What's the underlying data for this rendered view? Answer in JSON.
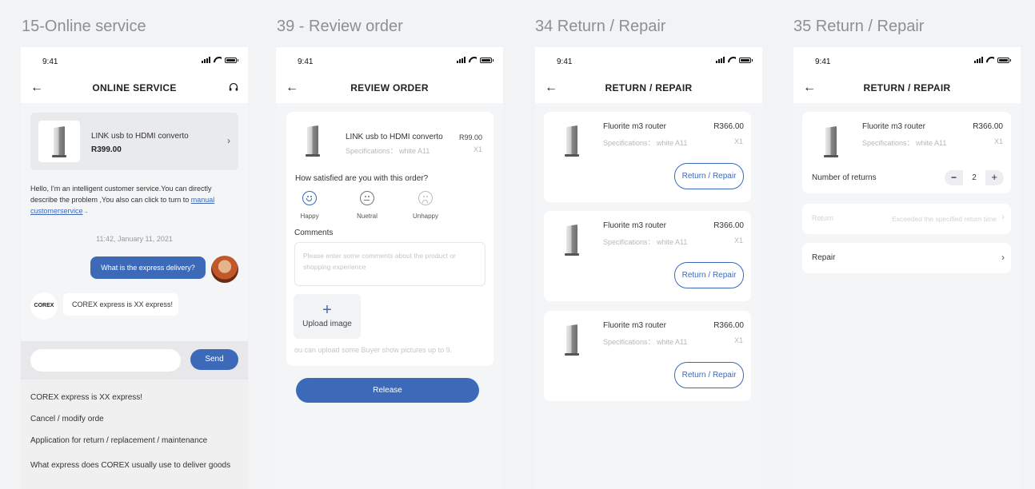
{
  "screens": {
    "s1": {
      "label": "15-Online service"
    },
    "s2": {
      "label": "39 - Review order"
    },
    "s3": {
      "label": "34  Return / Repair"
    },
    "s4": {
      "label": "35 Return / Repair"
    }
  },
  "status": {
    "time": "9:41"
  },
  "icons": {
    "back": "arrow-left-icon",
    "headset": "headset-icon",
    "chevron": "chevron-right-icon",
    "plus": "plus-icon"
  },
  "colors": {
    "accent": "#3d6ab8",
    "background": "#f4f5f7"
  },
  "online": {
    "title": "ONLINE SERVICE",
    "product": {
      "name": "LINK usb to HDMI converto",
      "price": "R399.00"
    },
    "intro_text": "Hello, I'm an intelligent customer service.You can directly describe the problem ,You  also can click to turn to ",
    "intro_link": "manual customerservice",
    "intro_link_arrow": "→",
    "timestamp": "11:42, January 11, 2021",
    "user_message": "What is the express delivery?",
    "bot_avatar": "COREX",
    "bot_message": "COREX express is XX express!",
    "input_placeholder": "",
    "send_label": "Send",
    "quick_questions": [
      "COREX express is XX express!",
      "Cancel / modify orde",
      "Application for return / replacement / maintenance",
      "What express does COREX usually use to deliver goods"
    ]
  },
  "review": {
    "title": "REVIEW ORDER",
    "product": {
      "name": "LINK usb to HDMI converto",
      "price": "R99.00",
      "spec": "Specifications： white A11",
      "qty": "X1"
    },
    "question": "How satisfied are you with this order?",
    "ratings": [
      {
        "label": "Happy",
        "icon": "happy-face-icon"
      },
      {
        "label": "Nuetral",
        "icon": "neutral-face-icon"
      },
      {
        "label": "Unhappy",
        "icon": "sad-face-icon"
      }
    ],
    "comments_label": "Comments",
    "comments_placeholder": "Please enter some comments about the product or shopping experience",
    "upload_label": "Upload image",
    "upload_hint": "ou can upload some Buyer show pictures up to 9.",
    "release_label": "Release"
  },
  "return_list": {
    "title": "RETURN / REPAIR",
    "items": [
      {
        "name": "Fluorite m3 router",
        "price": "R366.00",
        "spec": "Specifications： white A11",
        "qty": "X1",
        "button": "Return / Repair"
      },
      {
        "name": "Fluorite m3 router",
        "price": "R366.00",
        "spec": "Specifications： white A11",
        "qty": "X1",
        "button": "Return / Repair"
      },
      {
        "name": "Fluorite m3 router",
        "price": "R366.00",
        "spec": "Specifications： white A11",
        "qty": "X1",
        "button": "Return / Repair"
      }
    ]
  },
  "return_detail": {
    "title": "RETURN / REPAIR",
    "item": {
      "name": "Fluorite m3 router",
      "price": "R366.00",
      "spec": "Specifications： white A11",
      "qty": "X1"
    },
    "returns_label": "Number of returns",
    "returns_value": "2",
    "minus": "−",
    "plus": "+",
    "return_option": {
      "label": "Return",
      "note": "Exceeded the specified return time"
    },
    "repair_option": {
      "label": "Repair"
    }
  }
}
